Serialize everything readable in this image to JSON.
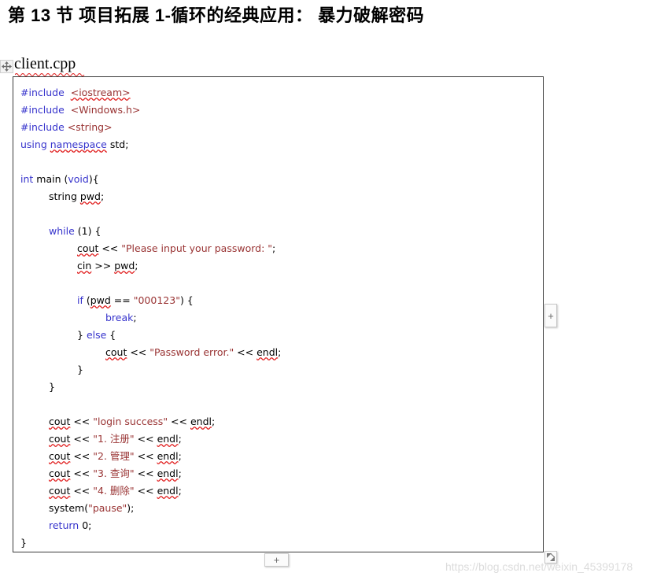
{
  "page": {
    "title": "第 13 节 项目拓展 1-循环的经典应用： 暴力破解密码",
    "watermark": "https://blog.csdn.net/weixin_45399178"
  },
  "file_caption": {
    "name": "client.cpp",
    "spellchecked": true
  },
  "toolbar": {
    "move_handle_icon": "move-four-arrows-icon",
    "add_column_label": "+",
    "add_row_label": "+",
    "resize_handle_icon": "resize-corner-icon"
  },
  "colors": {
    "keyword": "#3633CC",
    "preprocessor": "#3633CC",
    "string": "#993333",
    "plain": "#000000",
    "spellcheck_underline": "#E01B1B",
    "table_border": "#3A3A3A",
    "watermark": "#DCDCDC"
  },
  "code": {
    "language": "cpp",
    "filename": "client.cpp",
    "lines": [
      {
        "n": 1,
        "indent": 0,
        "tokens": [
          {
            "t": "#include",
            "c": "pp"
          },
          {
            "t": "  ",
            "c": "pl"
          },
          {
            "t": "<iostream>",
            "c": "str",
            "sq": true
          }
        ]
      },
      {
        "n": 2,
        "indent": 0,
        "tokens": [
          {
            "t": "#include",
            "c": "pp"
          },
          {
            "t": "  ",
            "c": "pl"
          },
          {
            "t": "<Windows.h>",
            "c": "str"
          }
        ]
      },
      {
        "n": 3,
        "indent": 0,
        "tokens": [
          {
            "t": "#include",
            "c": "pp"
          },
          {
            "t": " ",
            "c": "pl"
          },
          {
            "t": "<string>",
            "c": "str"
          }
        ]
      },
      {
        "n": 4,
        "indent": 0,
        "tokens": [
          {
            "t": "using",
            "c": "kw"
          },
          {
            "t": " ",
            "c": "pl"
          },
          {
            "t": "namespace",
            "c": "kw",
            "sq": true
          },
          {
            "t": " std;",
            "c": "pl"
          }
        ]
      },
      {
        "n": 5,
        "indent": 0,
        "tokens": []
      },
      {
        "n": 6,
        "indent": 0,
        "tokens": [
          {
            "t": "int",
            "c": "kw"
          },
          {
            "t": " main (",
            "c": "pl"
          },
          {
            "t": "void",
            "c": "kw"
          },
          {
            "t": "){",
            "c": "pl"
          }
        ]
      },
      {
        "n": 7,
        "indent": 1,
        "tokens": [
          {
            "t": "string ",
            "c": "pl"
          },
          {
            "t": "pwd",
            "c": "pl",
            "sq": true
          },
          {
            "t": ";",
            "c": "pl"
          }
        ]
      },
      {
        "n": 8,
        "indent": 0,
        "tokens": []
      },
      {
        "n": 9,
        "indent": 1,
        "tokens": [
          {
            "t": "while",
            "c": "kw"
          },
          {
            "t": " (1) {",
            "c": "pl"
          }
        ]
      },
      {
        "n": 10,
        "indent": 2,
        "tokens": [
          {
            "t": "cout",
            "c": "pl",
            "sq": true
          },
          {
            "t": " << ",
            "c": "pl"
          },
          {
            "t": "\"Please input your password: \"",
            "c": "str"
          },
          {
            "t": ";",
            "c": "pl"
          }
        ]
      },
      {
        "n": 11,
        "indent": 2,
        "tokens": [
          {
            "t": "cin",
            "c": "pl",
            "sq": true
          },
          {
            "t": " >> ",
            "c": "pl"
          },
          {
            "t": "pwd",
            "c": "pl",
            "sq": true
          },
          {
            "t": ";",
            "c": "pl"
          }
        ]
      },
      {
        "n": 12,
        "indent": 0,
        "tokens": []
      },
      {
        "n": 13,
        "indent": 2,
        "tokens": [
          {
            "t": "if",
            "c": "kw"
          },
          {
            "t": " (",
            "c": "pl"
          },
          {
            "t": "pwd",
            "c": "pl",
            "sq": true
          },
          {
            "t": " == ",
            "c": "pl"
          },
          {
            "t": "\"000123\"",
            "c": "str"
          },
          {
            "t": ") {",
            "c": "pl"
          }
        ]
      },
      {
        "n": 14,
        "indent": 3,
        "tokens": [
          {
            "t": "break",
            "c": "kw"
          },
          {
            "t": ";",
            "c": "pl"
          }
        ]
      },
      {
        "n": 15,
        "indent": 2,
        "tokens": [
          {
            "t": "} ",
            "c": "pl"
          },
          {
            "t": "else",
            "c": "kw"
          },
          {
            "t": " {",
            "c": "pl"
          }
        ]
      },
      {
        "n": 16,
        "indent": 3,
        "tokens": [
          {
            "t": "cout",
            "c": "pl",
            "sq": true
          },
          {
            "t": " << ",
            "c": "pl"
          },
          {
            "t": "\"Password error.\"",
            "c": "str"
          },
          {
            "t": " << ",
            "c": "pl"
          },
          {
            "t": "endl",
            "c": "pl",
            "sq": true
          },
          {
            "t": ";",
            "c": "pl"
          }
        ]
      },
      {
        "n": 17,
        "indent": 2,
        "tokens": [
          {
            "t": "}",
            "c": "pl"
          }
        ]
      },
      {
        "n": 18,
        "indent": 1,
        "tokens": [
          {
            "t": "}",
            "c": "pl"
          }
        ]
      },
      {
        "n": 19,
        "indent": 0,
        "tokens": []
      },
      {
        "n": 20,
        "indent": 1,
        "tokens": [
          {
            "t": "cout",
            "c": "pl",
            "sq": true
          },
          {
            "t": " << ",
            "c": "pl"
          },
          {
            "t": "\"login success\"",
            "c": "str"
          },
          {
            "t": " << ",
            "c": "pl"
          },
          {
            "t": "endl",
            "c": "pl",
            "sq": true
          },
          {
            "t": ";",
            "c": "pl"
          }
        ]
      },
      {
        "n": 21,
        "indent": 1,
        "tokens": [
          {
            "t": "cout",
            "c": "pl",
            "sq": true
          },
          {
            "t": " << ",
            "c": "pl"
          },
          {
            "t": "\"1. 注册\"",
            "c": "str"
          },
          {
            "t": " << ",
            "c": "pl"
          },
          {
            "t": "endl",
            "c": "pl",
            "sq": true
          },
          {
            "t": ";",
            "c": "pl"
          }
        ]
      },
      {
        "n": 22,
        "indent": 1,
        "tokens": [
          {
            "t": "cout",
            "c": "pl",
            "sq": true
          },
          {
            "t": " << ",
            "c": "pl"
          },
          {
            "t": "\"2. 管理\"",
            "c": "str"
          },
          {
            "t": " << ",
            "c": "pl"
          },
          {
            "t": "endl",
            "c": "pl",
            "sq": true
          },
          {
            "t": ";",
            "c": "pl"
          }
        ]
      },
      {
        "n": 23,
        "indent": 1,
        "tokens": [
          {
            "t": "cout",
            "c": "pl",
            "sq": true
          },
          {
            "t": " << ",
            "c": "pl"
          },
          {
            "t": "\"3. 查询\"",
            "c": "str"
          },
          {
            "t": " << ",
            "c": "pl"
          },
          {
            "t": "endl",
            "c": "pl",
            "sq": true
          },
          {
            "t": ";",
            "c": "pl"
          }
        ]
      },
      {
        "n": 24,
        "indent": 1,
        "tokens": [
          {
            "t": "cout",
            "c": "pl",
            "sq": true
          },
          {
            "t": " << ",
            "c": "pl"
          },
          {
            "t": "\"4. 删除\"",
            "c": "str"
          },
          {
            "t": " << ",
            "c": "pl"
          },
          {
            "t": "endl",
            "c": "pl",
            "sq": true
          },
          {
            "t": ";",
            "c": "pl"
          }
        ]
      },
      {
        "n": 25,
        "indent": 1,
        "tokens": [
          {
            "t": "system(",
            "c": "pl"
          },
          {
            "t": "\"pause\"",
            "c": "str"
          },
          {
            "t": ");",
            "c": "pl"
          }
        ]
      },
      {
        "n": 26,
        "indent": 1,
        "tokens": [
          {
            "t": "return",
            "c": "kw"
          },
          {
            "t": " 0;",
            "c": "pl"
          }
        ]
      },
      {
        "n": 27,
        "indent": 0,
        "tokens": [
          {
            "t": "}",
            "c": "pl"
          }
        ]
      }
    ]
  }
}
